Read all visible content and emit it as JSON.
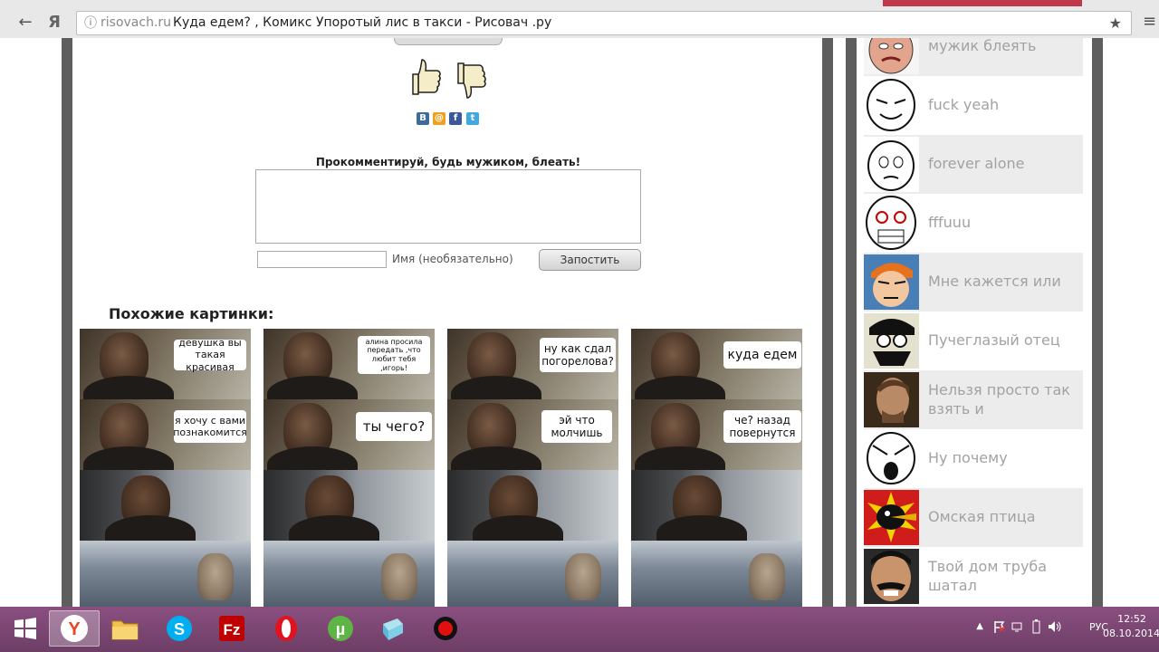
{
  "browser": {
    "back_icon": "←",
    "yandex_icon": "Я",
    "domain": "risovach.ru",
    "page_title": "Куда едем? , Комикс Упоротый лис в такси - Рисовач .ру",
    "star_icon": "★",
    "menu_icon": "≡"
  },
  "sharing": {
    "vk": "B",
    "mail": "@",
    "facebook": "f",
    "twitter": "t"
  },
  "comment": {
    "title": "Прокомментируй, будь мужиком, блеать!",
    "name_label": "Имя (необязательно)",
    "submit_label": "Запостить"
  },
  "similar": {
    "title": "Похожие картинки:",
    "comics": [
      {
        "bubble1": "девушка вы такая красивая",
        "bubble2": "я хочу с вами познакомится"
      },
      {
        "bubble1": "алина просила передать ,что любит тебя ,игорь!",
        "bubble2": "ты чего?"
      },
      {
        "bubble1": "ну как сдал погорелова?",
        "bubble2": "эй что молчишь"
      },
      {
        "bubble1": "куда едем",
        "bubble2": "че? назад повернутся"
      }
    ]
  },
  "sidebar": {
    "items": [
      {
        "label": "мужик блеять",
        "icon": "angry-man-face-icon"
      },
      {
        "label": "fuck yeah",
        "icon": "fuck-yeah-face-icon"
      },
      {
        "label": "forever alone",
        "icon": "forever-alone-face-icon"
      },
      {
        "label": "fffuuu",
        "icon": "rage-face-icon"
      },
      {
        "label": "Мне кажется или",
        "icon": "fry-face-icon"
      },
      {
        "label": "Пучеглазый отец",
        "icon": "bulging-eyes-dad-face-icon"
      },
      {
        "label": "Нельзя просто так взять и",
        "icon": "boromir-face-icon"
      },
      {
        "label": "Ну почему",
        "icon": "why-face-icon"
      },
      {
        "label": "Омская птица",
        "icon": "omsk-bird-icon"
      },
      {
        "label": "Твой дом труба шатал",
        "icon": "mustache-man-face-icon"
      }
    ]
  },
  "taskbar": {
    "lang": "РУС",
    "time": "12:52",
    "date": "08.10.2014"
  }
}
